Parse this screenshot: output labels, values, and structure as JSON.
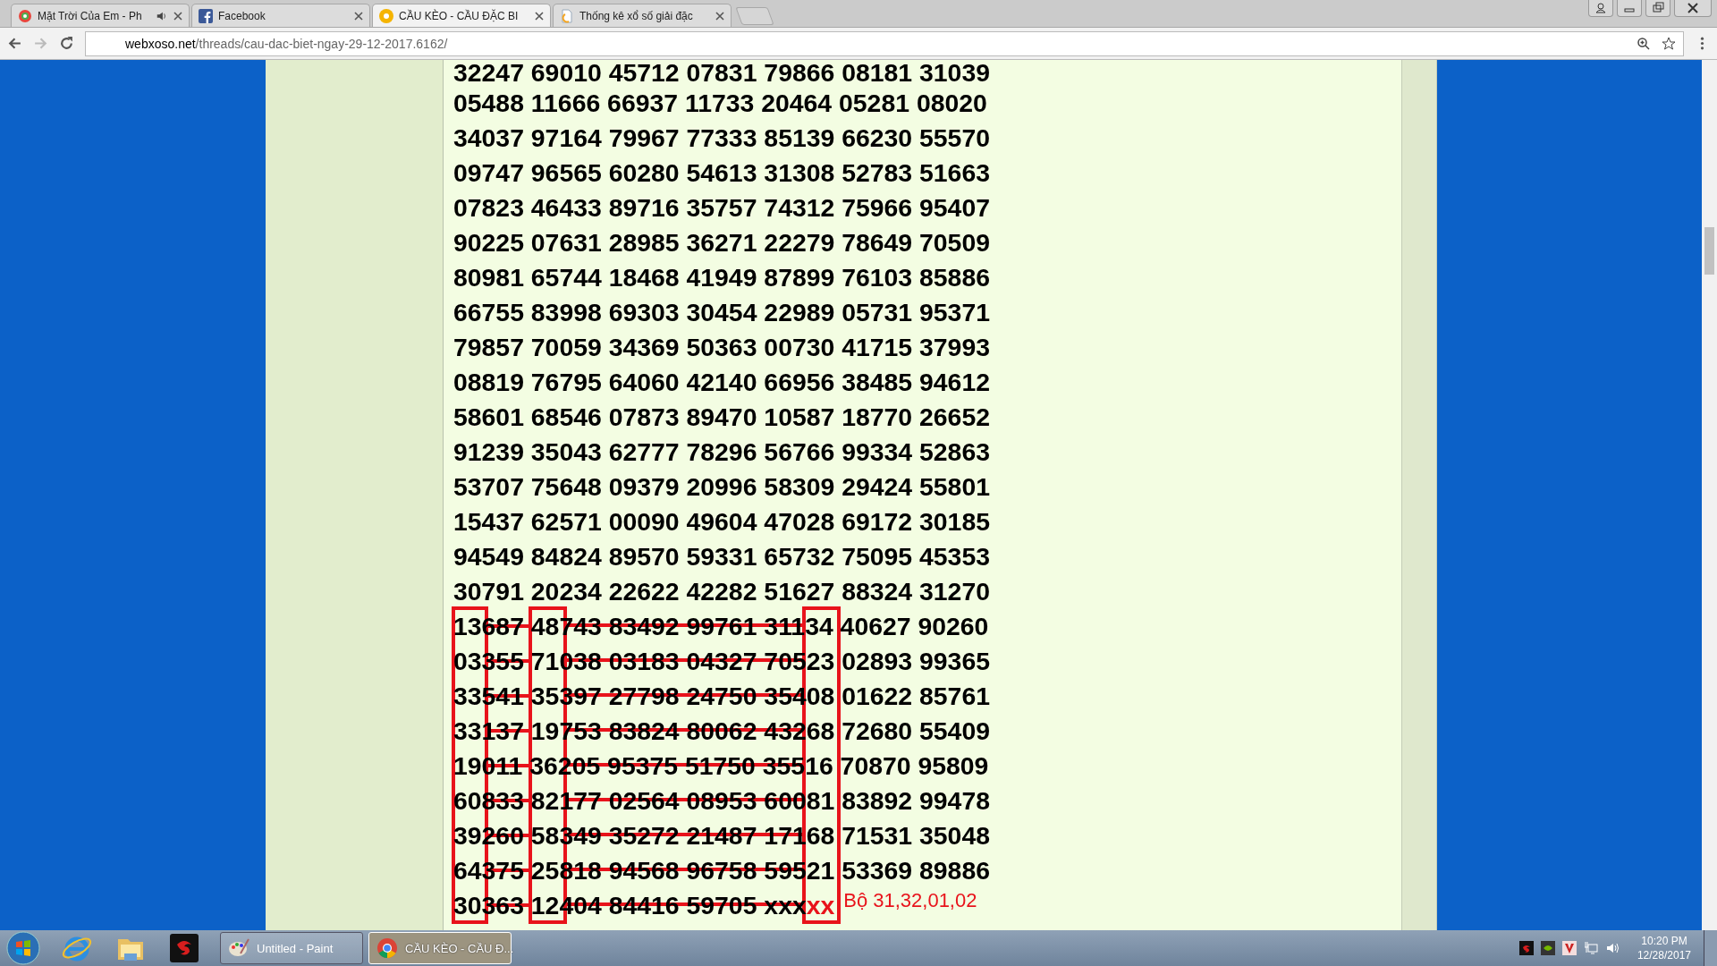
{
  "browser": {
    "tabs": [
      {
        "title": "Mặt Trời Của Em - Ph",
        "selected": false,
        "audio": true
      },
      {
        "title": "Facebook",
        "selected": false,
        "audio": false
      },
      {
        "title": "CẦU KÈO - CẦU ĐẶC BI",
        "selected": true,
        "audio": false
      },
      {
        "title": "Thống kê xổ số giải đặc",
        "selected": false,
        "audio": false
      }
    ],
    "address": {
      "host": "webxoso.net",
      "path": "/threads/cau-dac-biet-ngay-29-12-2017.6162/"
    }
  },
  "post": {
    "rows": [
      {
        "text": "32247 69010 45712 07831 79866 08181 31039",
        "struck": false
      },
      {
        "text": "05488 11666 66937 11733 20464 05281 08020",
        "struck": false
      },
      {
        "text": "34037 97164 79967 77333 85139 66230 55570",
        "struck": false
      },
      {
        "text": "09747 96565 60280 54613 31308 52783 51663",
        "struck": false
      },
      {
        "text": "07823 46433 89716 35757 74312 75966 95407",
        "struck": false
      },
      {
        "text": "90225 07631 28985 36271 22279 78649 70509",
        "struck": false
      },
      {
        "text": "80981 65744 18468 41949 87899 76103 85886",
        "struck": false
      },
      {
        "text": "66755 83998 69303 30454 22989 05731 95371",
        "struck": false
      },
      {
        "text": "79857 70059 34369 50363 00730 41715 37993",
        "struck": false
      },
      {
        "text": "08819 76795 64060 42140 66956 38485 94612",
        "struck": false
      },
      {
        "text": "58601 68546 07873 89470 10587 18770 26652",
        "struck": false
      },
      {
        "text": "91239 35043 62777 78296 56766 99334 52863",
        "struck": false
      },
      {
        "text": "53707 75648 09379 20996 58309 29424 55801",
        "struck": false
      },
      {
        "text": "15437 62571 00090 49604 47028 69172 30185",
        "struck": false
      },
      {
        "text": "94549 84824 89570 59331 65732 75095 45353",
        "struck": false
      },
      {
        "text": "30791 20234 22622 42282 51627 88324 31270",
        "struck": false
      },
      {
        "text": "13687 48743 83492 99761 31134 40627 90260",
        "struck": true
      },
      {
        "text": "03355 71038 03183 04327 70523 02893 99365",
        "struck": true
      },
      {
        "text": "33541 35397 27798 24750 35408 01622 85761",
        "struck": true
      },
      {
        "text": "33137 19753 83824 80062 43268 72680 55409",
        "struck": true
      },
      {
        "text": "19011 36205 95375 51750 35516 70870 95809",
        "struck": true
      },
      {
        "text": "60833 82177 02564 08953 60081 83892 99478",
        "struck": true
      },
      {
        "text": "39260 58349 35272 21487 17168 71531 35048",
        "struck": true
      },
      {
        "text": "64375 25818 94568 96758 59521 53369 89886",
        "struck": true
      },
      {
        "text": "30363 12404 84416 59705 xxx",
        "struck": true,
        "marked": "xx",
        "note": "Bộ 31,32,01,02"
      }
    ]
  },
  "taskbar": {
    "windows": [
      {
        "title": "Untitled - Paint",
        "selected": false
      },
      {
        "title": "CẦU KÈO - CẦU Đ...",
        "selected": true
      }
    ],
    "time": "10:20 PM",
    "date": "12/28/2017"
  }
}
